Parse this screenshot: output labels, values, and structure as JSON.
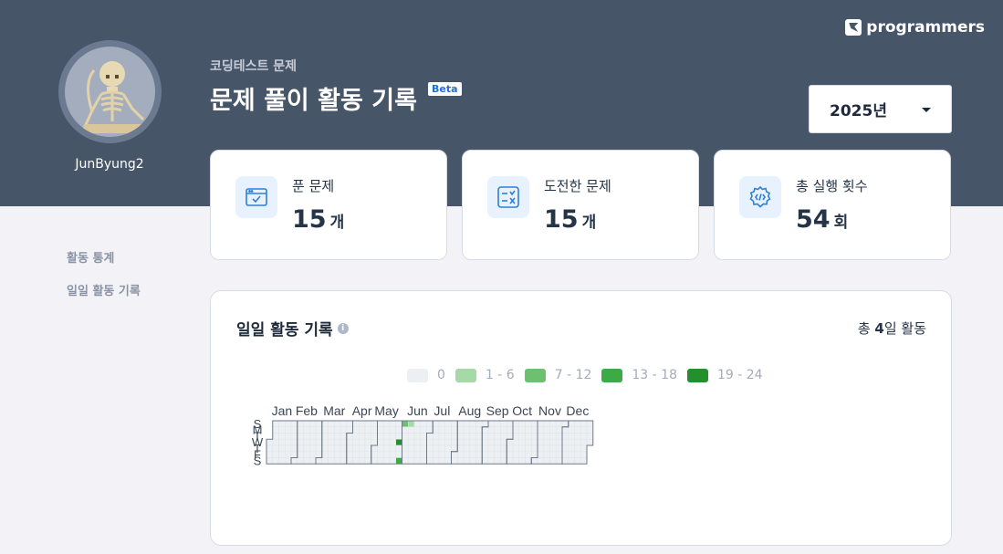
{
  "brand": {
    "name": "programmers"
  },
  "profile": {
    "username": "JunByung2",
    "avatar_icon": "skeleton-avatar"
  },
  "header": {
    "breadcrumb": "코딩테스트 문제",
    "title": "문제 풀이 활동 기록",
    "badge": "Beta"
  },
  "year_select": {
    "value": "2025년",
    "icon": "caret-down-icon"
  },
  "sidebar": {
    "items": [
      {
        "label": "활동 통계"
      },
      {
        "label": "일일 활동 기록"
      }
    ]
  },
  "stats": [
    {
      "label": "푼 문제",
      "value": "15",
      "unit": "개",
      "icon": "code-window-check-icon"
    },
    {
      "label": "도전한 문제",
      "value": "15",
      "unit": "개",
      "icon": "checklist-icon"
    },
    {
      "label": "총 실행 횟수",
      "value": "54",
      "unit": "회",
      "icon": "gear-code-icon"
    }
  ],
  "activity": {
    "title": "일일 활동 기록",
    "total_prefix": "총 ",
    "total_value": "4",
    "total_suffix": "일 활동",
    "legend": [
      {
        "label": "0",
        "color": "#edf0f3"
      },
      {
        "label": "1 - 6",
        "color": "#a6d8a8"
      },
      {
        "label": "7 - 12",
        "color": "#6dc06f"
      },
      {
        "label": "13 - 18",
        "color": "#3dab45"
      },
      {
        "label": "19 - 24",
        "color": "#23902b"
      }
    ],
    "months": [
      "Jan",
      "Feb",
      "Mar",
      "Apr",
      "May",
      "Jun",
      "Jul",
      "Aug",
      "Sep",
      "Oct",
      "Nov",
      "Dec"
    ],
    "weekdays": [
      "S",
      "M",
      "T",
      "W",
      "T",
      "F",
      "S"
    ]
  },
  "chart_data": {
    "type": "heatmap",
    "year": 2025,
    "levels": [
      "0",
      "1 - 6",
      "7 - 12",
      "13 - 18",
      "19 - 24"
    ],
    "active_days": [
      {
        "date": "2025-05-28",
        "level": 4
      },
      {
        "date": "2025-05-31",
        "level": 3
      },
      {
        "date": "2025-06-01",
        "level": 2
      },
      {
        "date": "2025-06-08",
        "level": 1
      }
    ]
  }
}
